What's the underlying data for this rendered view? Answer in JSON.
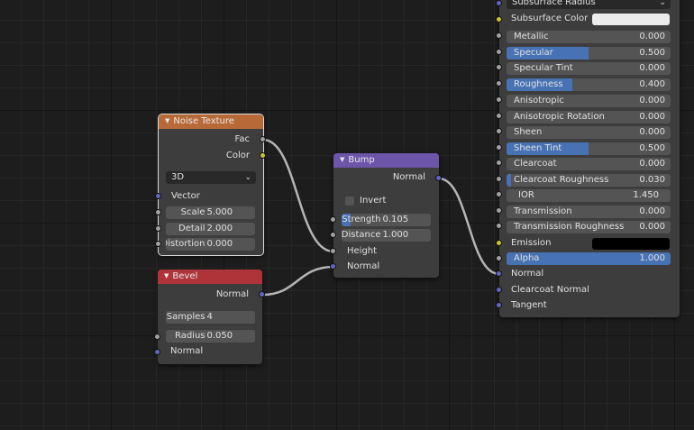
{
  "colors": {
    "socket_float": "#a1a1a1",
    "socket_color": "#c7c729",
    "socket_vector": "#6363c7",
    "slider_fill": "#4772b3",
    "header_texture": "#b76a37",
    "header_bevel": "#ae343a",
    "header_bump": "#6d55aa",
    "link": "#b5b5b5"
  },
  "noise": {
    "title": "Noise Texture",
    "out_fac": "Fac",
    "out_color": "Color",
    "dimension": "3D",
    "in_vector": "Vector",
    "scale_label": "Scale",
    "scale_value": "5.000",
    "detail_label": "Detail",
    "detail_value": "2.000",
    "distortion_label": "Distortion",
    "distortion_value": "0.000",
    "icon": "collapse-triangle-icon"
  },
  "bevel": {
    "title": "Bevel",
    "out_normal": "Normal",
    "samples_label": "Samples",
    "samples_value": "4",
    "radius_label": "Radius",
    "radius_value": "0.050",
    "in_normal": "Normal"
  },
  "bump": {
    "title": "Bump",
    "out_normal": "Normal",
    "invert_label": "Invert",
    "invert_checked": false,
    "strength_label": "Strength",
    "strength_value": "0.105",
    "strength_fraction": 0.105,
    "distance_label": "Distance",
    "distance_value": "1.000",
    "in_height": "Height",
    "in_normal": "Normal"
  },
  "bsdf": {
    "subsurface_radius": "Subsurface Radius",
    "subsurface_color_label": "Subsurface Color",
    "subsurface_color": "#ececec",
    "sliders": [
      {
        "label": "Metallic",
        "value": "0.000",
        "fraction": 0
      },
      {
        "label": "Specular",
        "value": "0.500",
        "fraction": 0.5
      },
      {
        "label": "Specular Tint",
        "value": "0.000",
        "fraction": 0
      },
      {
        "label": "Roughness",
        "value": "0.400",
        "fraction": 0.4
      },
      {
        "label": "Anisotropic",
        "value": "0.000",
        "fraction": 0
      },
      {
        "label": "Anisotropic Rotation",
        "value": "0.000",
        "fraction": 0
      },
      {
        "label": "Sheen",
        "value": "0.000",
        "fraction": 0
      },
      {
        "label": "Sheen Tint",
        "value": "0.500",
        "fraction": 0.5
      },
      {
        "label": "Clearcoat",
        "value": "0.000",
        "fraction": 0
      },
      {
        "label": "Clearcoat Roughness",
        "value": "0.030",
        "fraction": 0.03
      }
    ],
    "ior_label": "IOR",
    "ior_value": "1.450",
    "transmission_label": "Transmission",
    "transmission_value": "0.000",
    "transmission_roughness_label": "Transmission Roughness",
    "transmission_roughness_value": "0.000",
    "emission_label": "Emission",
    "emission_color": "#000000",
    "alpha_label": "Alpha",
    "alpha_value": "1.000",
    "alpha_fraction": 1.0,
    "in_normal": "Normal",
    "in_clearcoat_normal": "Clearcoat Normal",
    "in_tangent": "Tangent"
  }
}
